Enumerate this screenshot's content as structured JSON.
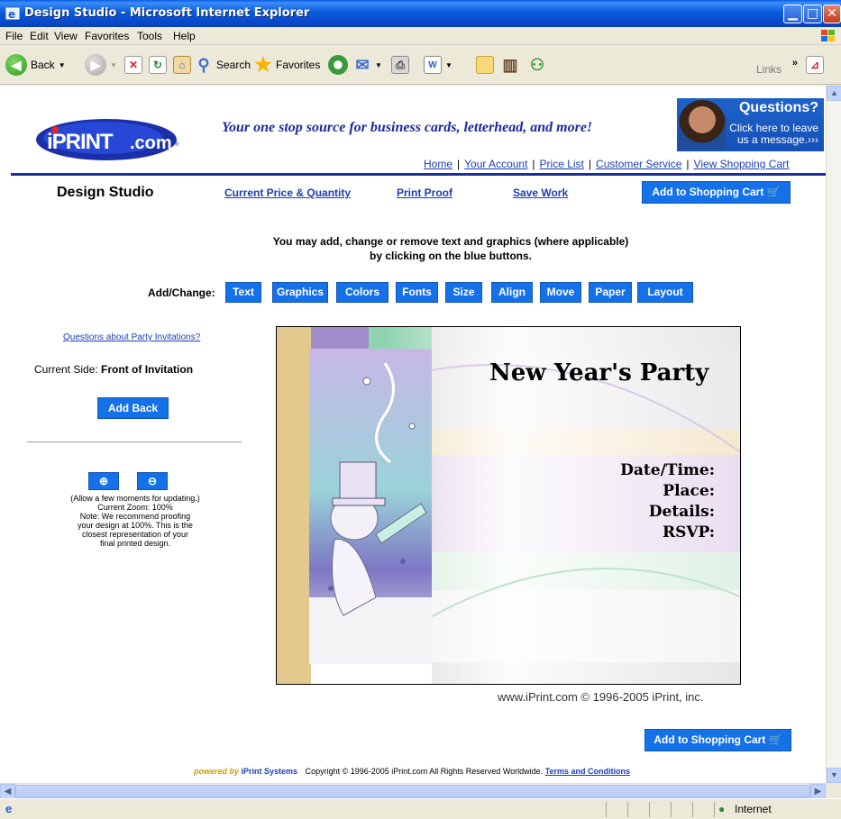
{
  "window": {
    "title": "Design Studio - Microsoft Internet Explorer"
  },
  "menu": [
    "File",
    "Edit",
    "View",
    "Favorites",
    "Tools",
    "Help"
  ],
  "toolbar": {
    "back": "Back",
    "search": "Search",
    "favorites": "Favorites",
    "links": "Links"
  },
  "header": {
    "tagline": "Your one stop source for business cards, letterhead, and more!",
    "questions_title": "Questions?",
    "questions_line1": "Click here to leave",
    "questions_line2": "us a message.›››"
  },
  "topnav": [
    "Home",
    "Your Account",
    "Price List",
    "Customer Service",
    "View Shopping Cart"
  ],
  "studio": {
    "title": "Design Studio",
    "links": [
      "Current Price & Quantity",
      "Print Proof",
      "Save Work"
    ],
    "cart_button": "Add to Shopping Cart"
  },
  "instructions": {
    "line1": "You may add, change or remove text and graphics (where applicable)",
    "line2": "by clicking on the blue buttons."
  },
  "tools": {
    "label": "Add/Change:",
    "buttons": [
      "Text",
      "Graphics",
      "Colors",
      "Fonts",
      "Size",
      "Align",
      "Move",
      "Paper",
      "Layout"
    ]
  },
  "sidebar": {
    "questions_link": "Questions about Party Invitations?",
    "current_side_label": "Current Side:",
    "current_side_value": "Front of Invitation",
    "add_back": "Add Back",
    "zoom_note": [
      "(Allow a few moments for updating.)",
      "Current Zoom: 100%",
      "Note: We recommend proofing",
      "your design at 100%. This is the",
      "closest representation of your",
      "final printed design."
    ]
  },
  "invitation": {
    "title": "New Year's Party",
    "fields": [
      "Date/Time:",
      "Place:",
      "Details:",
      "RSVP:"
    ]
  },
  "copyright_line": "www.iPrint.com © 1996-2005 iPrint, inc.",
  "footer": {
    "powered": "powered by",
    "systems": "iPrint Systems",
    "copyright": "Copyright © 1996-2005 iPrint.com All Rights Reserved Worldwide.",
    "terms": "Terms and Conditions"
  },
  "status": {
    "zone": "Internet"
  }
}
